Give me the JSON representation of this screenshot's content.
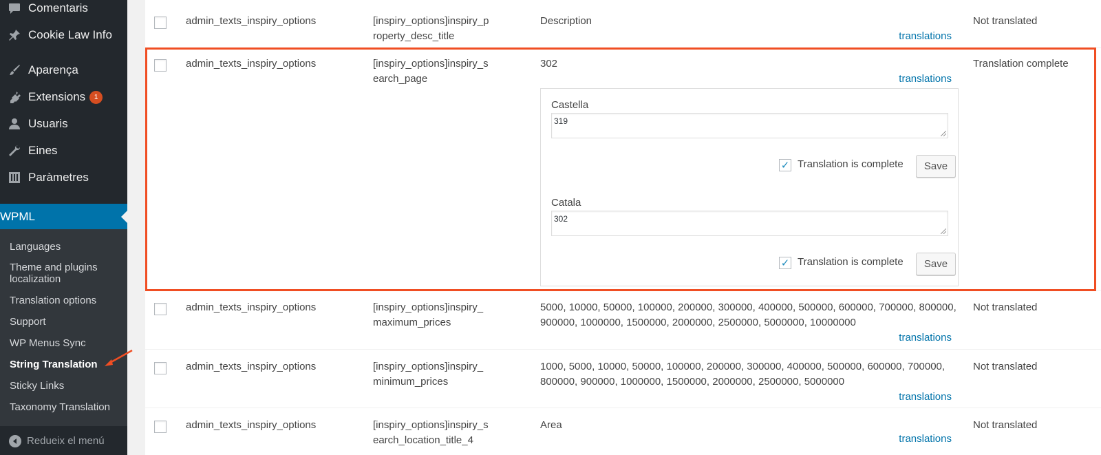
{
  "sidebar": {
    "menu": [
      {
        "label": "Comentaris",
        "icon": "comment-icon"
      },
      {
        "label": "Cookie Law Info",
        "icon": "pin-icon"
      },
      {
        "label": "Aparença",
        "icon": "paintbrush-icon"
      },
      {
        "label": "Extensions",
        "icon": "plugin-icon",
        "badge": "1"
      },
      {
        "label": "Usuaris",
        "icon": "user-icon"
      },
      {
        "label": "Eines",
        "icon": "wrench-icon"
      },
      {
        "label": "Paràmetres",
        "icon": "settings-sliders-icon"
      }
    ],
    "wpml": {
      "label": "WPML",
      "icon": "wpml-icon"
    },
    "submenu": [
      {
        "label": "Languages"
      },
      {
        "label": "Theme and plugins localization"
      },
      {
        "label": "Translation options"
      },
      {
        "label": "Support"
      },
      {
        "label": "WP Menus Sync"
      },
      {
        "label": "String Translation"
      },
      {
        "label": "Sticky Links"
      },
      {
        "label": "Taxonomy Translation"
      }
    ],
    "collapse_label": "Redueix el menú"
  },
  "rows": [
    {
      "context": "admin_texts_inspiry_options",
      "name": "[inspiry_options]inspiry_property_desc_title",
      "value": "Description",
      "link": "translations",
      "status": "Not translated"
    },
    {
      "context": "admin_texts_inspiry_options",
      "name": "[inspiry_options]inspiry_search_page",
      "value": "302",
      "link": "translations",
      "status": "Translation complete"
    },
    {
      "context": "admin_texts_inspiry_options",
      "name": "[inspiry_options]inspiry_maximum_prices",
      "value": "5000, 10000, 50000, 100000, 200000, 300000, 400000, 500000, 600000, 700000, 800000, 900000, 1000000, 1500000, 2000000, 2500000, 5000000, 10000000",
      "link": "translations",
      "status": "Not translated"
    },
    {
      "context": "admin_texts_inspiry_options",
      "name": "[inspiry_options]inspiry_minimum_prices",
      "value": "1000, 5000, 10000, 50000, 100000, 200000, 300000, 400000, 500000, 600000, 700000, 800000, 900000, 1000000, 1500000, 2000000, 2500000, 5000000",
      "link": "translations",
      "status": "Not translated"
    },
    {
      "context": "admin_texts_inspiry_options",
      "name": "[inspiry_options]inspiry_search_location_title_4",
      "value": "Area",
      "link": "translations",
      "status": "Not translated"
    }
  ],
  "translations": [
    {
      "language": "Castella",
      "text": "319",
      "complete_label": "Translation is complete",
      "complete": true,
      "save_label": "Save"
    },
    {
      "language": "Catala",
      "text": "302",
      "complete_label": "Translation is complete",
      "complete": true,
      "save_label": "Save"
    }
  ],
  "colors": {
    "accent": "#0073aa",
    "highlight": "#f04e23",
    "sidebar": "#23282d",
    "badge": "#d54e21"
  }
}
